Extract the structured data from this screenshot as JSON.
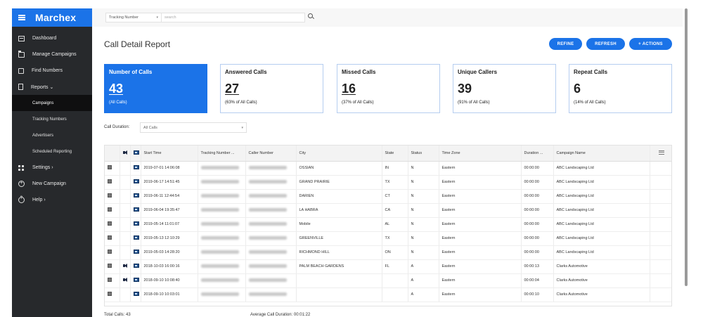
{
  "app": {
    "logo": "Marchex"
  },
  "sidebar": {
    "items": [
      {
        "label": "Dashboard",
        "icon": "dashboard-icon"
      },
      {
        "label": "Manage Campaigns",
        "icon": "folder-icon"
      },
      {
        "label": "Find Numbers",
        "icon": "phone-icon"
      },
      {
        "label": "Reports ⌄",
        "icon": "report-icon"
      }
    ],
    "sub_items": [
      {
        "label": "Campaigns",
        "active": true
      },
      {
        "label": "Tracking Numbers",
        "active": false
      },
      {
        "label": "Advertisers",
        "active": false
      },
      {
        "label": "Scheduled Reporting",
        "active": false
      }
    ],
    "bottom_items": [
      {
        "label": "Settings ›",
        "icon": "grid-icon"
      },
      {
        "label": "New Campaign",
        "icon": "plus-circle-icon"
      },
      {
        "label": "Help ›",
        "icon": "help-icon"
      }
    ]
  },
  "topbar": {
    "search_type": "Tracking Number",
    "search_placeholder": "search"
  },
  "page": {
    "title": "Call Detail Report",
    "buttons": {
      "refine": "REFINE",
      "refresh": "REFRESH",
      "actions": "+ ACTIONS"
    }
  },
  "stats": [
    {
      "title": "Number of Calls",
      "value": "43",
      "sub": "(All Calls)"
    },
    {
      "title": "Answered Calls",
      "value": "27",
      "sub": "(63% of All Calls)"
    },
    {
      "title": "Missed Calls",
      "value": "16",
      "sub": "(37% of All Calls)"
    },
    {
      "title": "Unique Callers",
      "value": "39",
      "sub": "(91% of All Calls)"
    },
    {
      "title": "Repeat Calls",
      "value": "6",
      "sub": "(14% of All Calls)"
    }
  ],
  "filter": {
    "label": "Call Duration:",
    "value": "All Calls"
  },
  "table": {
    "columns": [
      "Start Time",
      "Tracking Number ...",
      "Caller Number",
      "City",
      "State",
      "Status",
      "Time Zone",
      "Duration ...",
      "Campaign Name"
    ],
    "rows": [
      {
        "audio": false,
        "start": "2019-07-01 14:06:08",
        "city": "OSSIAN",
        "state": "IN",
        "status": "N",
        "tz": "Eastern",
        "duration": "00:00:00",
        "campaign": "ABC Landscaping Ltd"
      },
      {
        "audio": false,
        "start": "2019-06-17 14:51:45",
        "city": "GRAND PRAIRIE",
        "state": "TX",
        "status": "N",
        "tz": "Eastern",
        "duration": "00:00:00",
        "campaign": "ABC Landscaping Ltd"
      },
      {
        "audio": false,
        "start": "2019-06-11 12:44:54",
        "city": "DARIEN",
        "state": "CT",
        "status": "N",
        "tz": "Eastern",
        "duration": "00:00:00",
        "campaign": "ABC Landscaping Ltd"
      },
      {
        "audio": false,
        "start": "2019-06-04 19:35:47",
        "city": "LA HABRA",
        "state": "CA",
        "status": "N",
        "tz": "Eastern",
        "duration": "00:00:00",
        "campaign": "ABC Landscaping Ltd"
      },
      {
        "audio": false,
        "start": "2019-05-14 11:01:07",
        "city": "Mobile",
        "state": "AL",
        "status": "N",
        "tz": "Eastern",
        "duration": "00:00:00",
        "campaign": "ABC Landscaping Ltd"
      },
      {
        "audio": false,
        "start": "2019-05-13 12:10:29",
        "city": "GREENVILLE",
        "state": "TX",
        "status": "N",
        "tz": "Eastern",
        "duration": "00:00:00",
        "campaign": "ABC Landscaping Ltd"
      },
      {
        "audio": false,
        "start": "2019-05-03 14:28:20",
        "city": "RICHMOND HILL",
        "state": "ON",
        "status": "N",
        "tz": "Eastern",
        "duration": "00:00:00",
        "campaign": "ABC Landscaping Ltd"
      },
      {
        "audio": true,
        "start": "2018-10-03 16:00:16",
        "city": "PALM BEACH GARDENS",
        "state": "FL",
        "status": "A",
        "tz": "Eastern",
        "duration": "00:00:13",
        "campaign": "Clarks Automotive"
      },
      {
        "audio": true,
        "start": "2018-09-10 10:08:40",
        "city": "",
        "state": "",
        "status": "A",
        "tz": "Eastern",
        "duration": "00:00:04",
        "campaign": "Clarks Automotive"
      },
      {
        "audio": false,
        "start": "2018-09-10 10:03:01",
        "city": "",
        "state": "",
        "status": "A",
        "tz": "Eastern",
        "duration": "00:00:10",
        "campaign": "Clarks Automotive"
      }
    ]
  },
  "footer": {
    "total": "Total Calls: 43",
    "avg": "Average Call Duration: 00:01:22"
  }
}
